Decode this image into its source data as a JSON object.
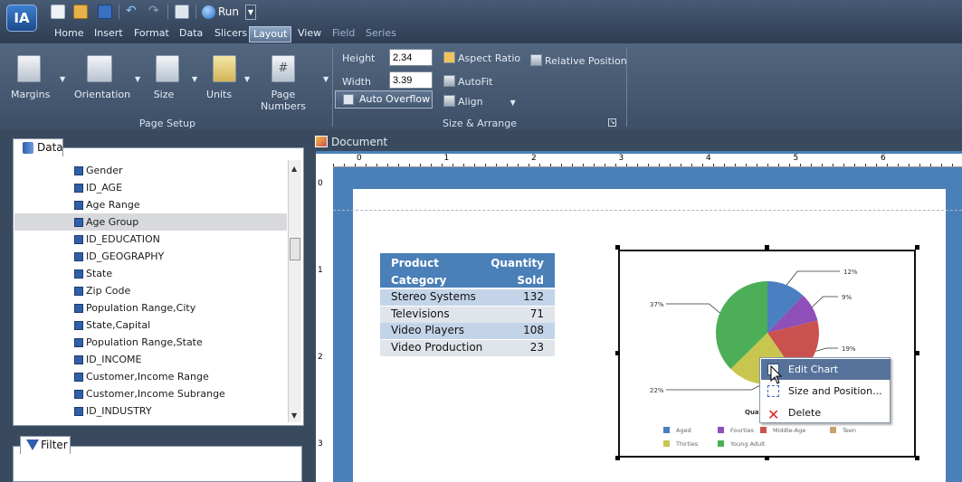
{
  "app": {
    "logo": "IA",
    "run_label": "Run"
  },
  "tabs": [
    "Home",
    "Insert",
    "Format",
    "Data",
    "Slicers",
    "Layout",
    "View",
    "Field",
    "Series"
  ],
  "ribbon": {
    "page_setup": {
      "margins": "Margins",
      "orientation": "Orientation",
      "size": "Size",
      "units": "Units",
      "page_numbers": "Page\nNumbers",
      "group_label": "Page Setup"
    },
    "size_arrange": {
      "height_label": "Height",
      "height_value": "2.34",
      "width_label": "Width",
      "width_value": "3.39",
      "auto_overflow": "Auto Overflow",
      "aspect_ratio": "Aspect Ratio",
      "autofit": "AutoFit",
      "align": "Align",
      "relative_position": "Relative Position",
      "group_label": "Size & Arrange"
    }
  },
  "data_panel": {
    "title": "Data",
    "items": [
      "Gender",
      "ID_AGE",
      "Age Range",
      "Age Group",
      "ID_EDUCATION",
      "ID_GEOGRAPHY",
      "State",
      "Zip Code",
      "Population Range,City",
      "State,Capital",
      "Population Range,State",
      "ID_INCOME",
      "Customer,Income Range",
      "Customer,Income Subrange",
      "ID_INDUSTRY"
    ],
    "selected_index": 3
  },
  "filter_panel": {
    "title": "Filter"
  },
  "document": {
    "title": "Document",
    "ruler_h": [
      "0",
      "1",
      "2",
      "3",
      "4",
      "5",
      "6"
    ],
    "ruler_v": [
      "0",
      "1",
      "2",
      "3"
    ]
  },
  "report_table": {
    "headers": [
      [
        "Product",
        "Quantity"
      ],
      [
        "Category",
        "Sold"
      ]
    ],
    "rows": [
      [
        "Stereo Systems",
        "132"
      ],
      [
        "Televisions",
        "71"
      ],
      [
        "Video Players",
        "108"
      ],
      [
        "Video Production",
        "23"
      ]
    ]
  },
  "chart_data": {
    "type": "pie",
    "title": "Quar",
    "slices": [
      {
        "name": "Aged",
        "value": 12,
        "color": "#4a7fc1"
      },
      {
        "name": "Fourties",
        "value": 9,
        "color": "#8e4fb8"
      },
      {
        "name": "Middle-Age",
        "value": 19,
        "color": "#c9524f"
      },
      {
        "name": "Thirties",
        "value": 22,
        "color": "#c8c64f"
      },
      {
        "name": "Young Adult",
        "value": 37,
        "color": "#4caf57"
      }
    ],
    "labels": [
      "12%",
      "9%",
      "19%",
      "22%",
      "37%"
    ],
    "legend": [
      "Aged",
      "Fourties",
      "Middle-Age",
      "Teen",
      "Thirties",
      "Young Adult"
    ],
    "legend_colors": [
      "#4a7fc1",
      "#8e4fb8",
      "#c9524f",
      "#c9a070",
      "#c8c64f",
      "#4caf57"
    ]
  },
  "context_menu": {
    "items": [
      "Edit Chart",
      "Size and Position...",
      "Delete"
    ]
  }
}
